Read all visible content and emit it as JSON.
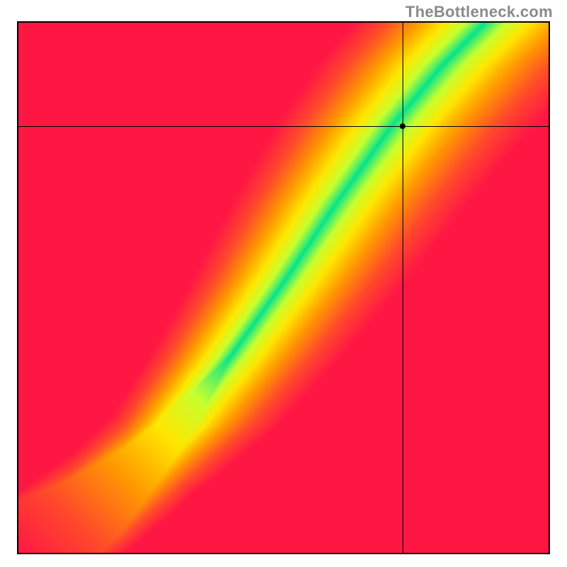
{
  "watermark": "TheBottleneck.com",
  "chart_data": {
    "type": "heatmap",
    "title": "",
    "xlabel": "",
    "ylabel": "",
    "xlim": [
      0,
      1
    ],
    "ylim": [
      0,
      1
    ],
    "grid": false,
    "legend": false,
    "optimal_ridge": {
      "description": "green optimal band roughly y ≈ x^1.25 with slight S-curve; width ≈ 0.06 in normalized units",
      "width": 0.06,
      "points": [
        {
          "x": 0.0,
          "y": 0.0
        },
        {
          "x": 0.1,
          "y": 0.06
        },
        {
          "x": 0.2,
          "y": 0.14
        },
        {
          "x": 0.3,
          "y": 0.24
        },
        {
          "x": 0.4,
          "y": 0.37
        },
        {
          "x": 0.5,
          "y": 0.51
        },
        {
          "x": 0.6,
          "y": 0.66
        },
        {
          "x": 0.7,
          "y": 0.8
        },
        {
          "x": 0.8,
          "y": 0.92
        },
        {
          "x": 0.88,
          "y": 1.0
        }
      ]
    },
    "color_stops": [
      {
        "t": 0.0,
        "hex": "#00e38e"
      },
      {
        "t": 0.18,
        "hex": "#c8ff2e"
      },
      {
        "t": 0.35,
        "hex": "#ffe600"
      },
      {
        "t": 0.55,
        "hex": "#ff9a00"
      },
      {
        "t": 0.78,
        "hex": "#ff4a2a"
      },
      {
        "t": 1.0,
        "hex": "#ff1744"
      }
    ],
    "marker": {
      "x": 0.725,
      "y": 0.805
    },
    "crosshair": {
      "x": 0.725,
      "y": 0.805
    }
  }
}
